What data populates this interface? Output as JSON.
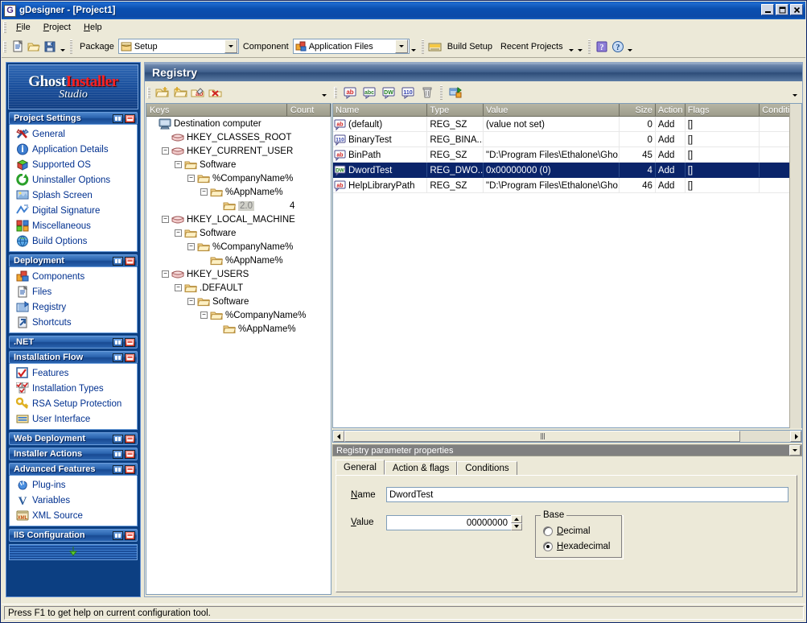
{
  "window": {
    "title": "gDesigner - [Project1]",
    "icon": "G",
    "buttons": [
      {
        "name": "minimize-button",
        "glyph": "minimize"
      },
      {
        "name": "maximize-button",
        "glyph": "maximize"
      },
      {
        "name": "close-button",
        "glyph": "close"
      }
    ]
  },
  "menu": {
    "items": [
      "File",
      "Project",
      "Help"
    ]
  },
  "toolbar": {
    "new_icon": "new-document-icon",
    "open_icon": "open-folder-icon",
    "save_icon": "save-disk-icon",
    "package_label": "Package",
    "package_value": "Setup",
    "package_icon": "package-box-icon",
    "component_label": "Component",
    "component_value": "Application Files",
    "component_icon": "component-icon",
    "build_setup_label": "Build Setup",
    "build_setup_icon": "build-icon",
    "recent_projects_label": "Recent Projects",
    "help_icon": "help-question-icon",
    "help_about_icon": "help-about-icon"
  },
  "sidebar": {
    "logo": {
      "line1_a": "Ghost",
      "line1_b": "Installer",
      "line2": "Studio"
    },
    "groups": [
      {
        "title": "Project Settings",
        "expanded": true,
        "items": [
          {
            "label": "General",
            "icon": "tools-icon"
          },
          {
            "label": "Application Details",
            "icon": "info-icon"
          },
          {
            "label": "Supported OS",
            "icon": "cube-icon"
          },
          {
            "label": "Uninstaller Options",
            "icon": "refresh-green-icon"
          },
          {
            "label": "Splash Screen",
            "icon": "splash-image-icon"
          },
          {
            "label": "Digital Signature",
            "icon": "signature-icon"
          },
          {
            "label": "Miscellaneous",
            "icon": "misc-blocks-icon"
          },
          {
            "label": "Build Options",
            "icon": "globe-icon"
          }
        ]
      },
      {
        "title": "Deployment",
        "expanded": true,
        "items": [
          {
            "label": "Components",
            "icon": "component-icon"
          },
          {
            "label": "Files",
            "icon": "file-page-icon"
          },
          {
            "label": "Registry",
            "icon": "registry-icon"
          },
          {
            "label": "Shortcuts",
            "icon": "shortcut-icon"
          }
        ]
      },
      {
        "title": ".NET",
        "expanded": false,
        "items": []
      },
      {
        "title": "Installation Flow",
        "expanded": true,
        "items": [
          {
            "label": "Features",
            "icon": "checkbox-icon"
          },
          {
            "label": "Installation Types",
            "icon": "install-types-icon"
          },
          {
            "label": "RSA Setup Protection",
            "icon": "key-icon"
          },
          {
            "label": "User Interface",
            "icon": "ui-bars-icon"
          }
        ]
      },
      {
        "title": "Web Deployment",
        "expanded": false,
        "items": []
      },
      {
        "title": "Installer Actions",
        "expanded": false,
        "items": []
      },
      {
        "title": "Advanced Features",
        "expanded": true,
        "items": [
          {
            "label": "Plug-ins",
            "icon": "plugin-icon"
          },
          {
            "label": "Variables",
            "icon": "variable-v-icon"
          },
          {
            "label": "XML Source",
            "icon": "xml-icon"
          }
        ]
      },
      {
        "title": "IIS Configuration",
        "expanded": false,
        "items": []
      }
    ],
    "scroll_down_icon": "scroll-down-arrow-icon"
  },
  "page": {
    "title": "Registry"
  },
  "tree_toolbar": {
    "icons": [
      {
        "name": "add-key-icon"
      },
      {
        "name": "add-subkey-icon"
      },
      {
        "name": "rename-key-icon"
      },
      {
        "name": "delete-key-icon"
      }
    ]
  },
  "tree": {
    "columns": [
      "Keys",
      "Count"
    ],
    "nodes": [
      {
        "label": "Destination computer",
        "depth": 0,
        "expander": "none",
        "icon": "computer-icon"
      },
      {
        "label": "HKEY_CLASSES_ROOT",
        "depth": 1,
        "expander": "none",
        "icon": "hive-icon"
      },
      {
        "label": "HKEY_CURRENT_USER",
        "depth": 1,
        "expander": "minus",
        "icon": "hive-icon"
      },
      {
        "label": "Software",
        "depth": 2,
        "expander": "minus",
        "icon": "folder-icon"
      },
      {
        "label": "%CompanyName%",
        "depth": 3,
        "expander": "minus",
        "icon": "folder-icon"
      },
      {
        "label": "%AppName%",
        "depth": 4,
        "expander": "minus",
        "icon": "folder-icon"
      },
      {
        "label": "2.0",
        "depth": 5,
        "expander": "none",
        "icon": "folder-icon",
        "selected": true,
        "count": "4"
      },
      {
        "label": "HKEY_LOCAL_MACHINE",
        "depth": 1,
        "expander": "minus",
        "icon": "hive-icon"
      },
      {
        "label": "Software",
        "depth": 2,
        "expander": "minus",
        "icon": "folder-icon"
      },
      {
        "label": "%CompanyName%",
        "depth": 3,
        "expander": "minus",
        "icon": "folder-icon"
      },
      {
        "label": "%AppName%",
        "depth": 4,
        "expander": "none",
        "icon": "folder-icon"
      },
      {
        "label": "HKEY_USERS",
        "depth": 1,
        "expander": "minus",
        "icon": "hive-icon"
      },
      {
        "label": ".DEFAULT",
        "depth": 2,
        "expander": "minus",
        "icon": "folder-icon"
      },
      {
        "label": "Software",
        "depth": 3,
        "expander": "minus",
        "icon": "folder-icon"
      },
      {
        "label": "%CompanyName%",
        "depth": 4,
        "expander": "minus",
        "icon": "folder-icon"
      },
      {
        "label": "%AppName%",
        "depth": 5,
        "expander": "none",
        "icon": "folder-icon"
      }
    ]
  },
  "list_toolbar": {
    "icons": [
      {
        "name": "new-string-value-icon"
      },
      {
        "name": "new-expand-string-value-icon"
      },
      {
        "name": "new-dword-value-icon"
      },
      {
        "name": "new-binary-value-icon"
      },
      {
        "name": "delete-value-icon"
      },
      {
        "name": "import-registry-icon"
      }
    ]
  },
  "list": {
    "columns": [
      "Name",
      "Type",
      "Value",
      "Size",
      "Action",
      "Flags",
      "Condition"
    ],
    "rows": [
      {
        "name": "(default)",
        "type": "REG_SZ",
        "value": "(value not set)",
        "size": "0",
        "action": "Add",
        "flags": "[]",
        "condition": "",
        "icon": "string-value-icon",
        "selected": false
      },
      {
        "name": "BinaryTest",
        "type": "REG_BINA...",
        "value": "",
        "size": "0",
        "action": "Add",
        "flags": "[]",
        "condition": "",
        "icon": "binary-value-icon",
        "selected": false
      },
      {
        "name": "BinPath",
        "type": "REG_SZ",
        "value": "\"D:\\Program Files\\Ethalone\\Gho...",
        "size": "45",
        "action": "Add",
        "flags": "[]",
        "condition": "",
        "icon": "string-value-icon",
        "selected": false
      },
      {
        "name": "DwordTest",
        "type": "REG_DWO...",
        "value": "0x00000000 (0)",
        "size": "4",
        "action": "Add",
        "flags": "[]",
        "condition": "",
        "icon": "dword-value-icon",
        "selected": true
      },
      {
        "name": "HelpLibraryPath",
        "type": "REG_SZ",
        "value": "\"D:\\Program Files\\Ethalone\\Gho...",
        "size": "46",
        "action": "Add",
        "flags": "[]",
        "condition": "",
        "icon": "string-value-icon",
        "selected": false
      }
    ]
  },
  "properties": {
    "header": "Registry parameter properties",
    "tabs": [
      {
        "label": "General",
        "active": true
      },
      {
        "label": "Action & flags",
        "active": false
      },
      {
        "label": "Conditions",
        "active": false
      }
    ],
    "name_label": "Name",
    "name_value": "DwordTest",
    "value_label": "Value",
    "value_value": "00000000",
    "base_group": "Base",
    "base_options": [
      {
        "label": "Decimal",
        "selected": false
      },
      {
        "label": "Hexadecimal",
        "selected": true
      }
    ]
  },
  "statusbar": {
    "text": "Press F1 to get help on current configuration tool."
  },
  "colors": {
    "titlebar": "#0a4fb0",
    "face": "#ece9d8",
    "selection": "#0a246a",
    "sidebar_blue": "#0c3f82",
    "link_text": "#00308f",
    "logo_red": "#ff2020",
    "header_gray": "#9d9c8b"
  }
}
